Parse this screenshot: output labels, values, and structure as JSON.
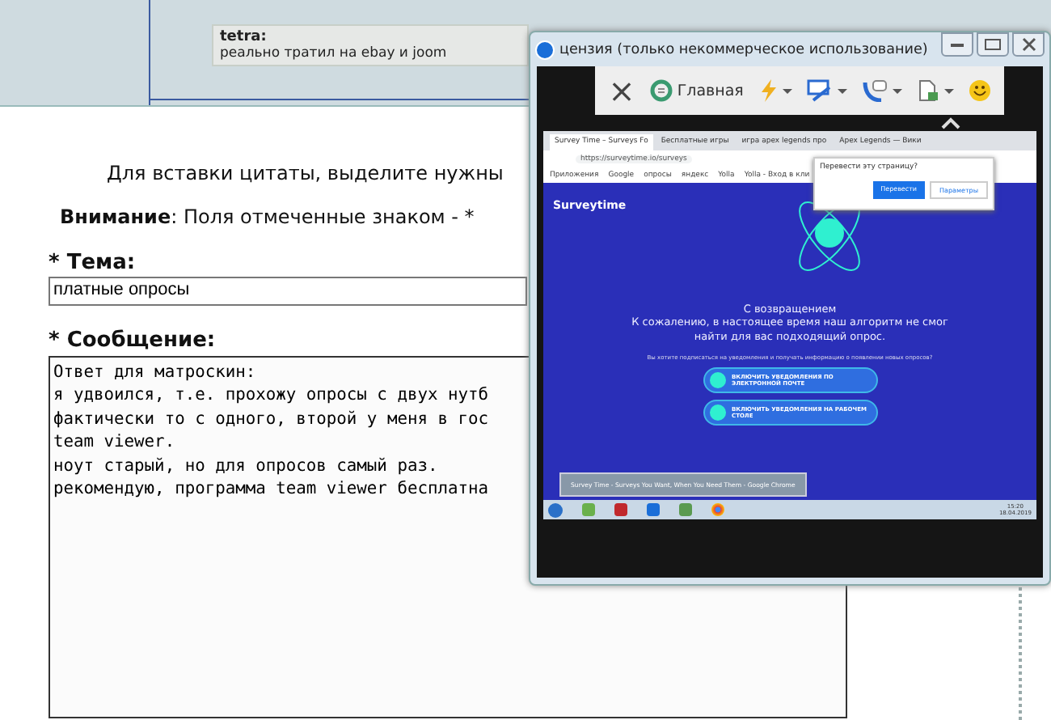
{
  "quote": {
    "author": "tetra:",
    "text": "реально тратил на ebay и joom"
  },
  "form": {
    "hint": "Для вставки цитаты, выделите нужны",
    "warning": "**Внимание**: Поля отмеченные знаком - *",
    "subject_label": "* Тема:",
    "subject_value": "платные опросы",
    "message_label": "* Сообщение:",
    "message_lines": [
      "Ответ для матроскин:",
      "я удвоился, т.е. прохожу опросы с двух нутб",
      "фактически то с одного, второй у меня в гос",
      "team viewer.",
      "ноут старый, но для опросов самый раз.",
      "рекомендую, программа team viewer бесплатна"
    ]
  },
  "remote_window": {
    "title": "цензия (только некоммерческое использование)",
    "toolbar": [
      {
        "kind": "close",
        "label": "×"
      },
      {
        "kind": "home",
        "label": "Главная"
      },
      {
        "kind": "actions"
      },
      {
        "kind": "view"
      },
      {
        "kind": "communicate"
      },
      {
        "kind": "files"
      },
      {
        "kind": "smiley"
      }
    ],
    "browser": {
      "tabs": [
        {
          "label": "Survey Time – Surveys Fo",
          "selected": true
        },
        {
          "label": "Бесплатные игры",
          "selected": false
        },
        {
          "label": "игра apex legends про",
          "selected": false
        },
        {
          "label": "Apex Legends — Вики",
          "selected": false
        }
      ],
      "url": "https://surveytime.io/surveys",
      "bookmarks": [
        "Приложения",
        "Google",
        "опросы",
        "яндекс",
        "Yolla",
        "Yolla - Вход в кли"
      ],
      "translate_popup": {
        "question": "Перевести эту страницу?",
        "primary": "Перевести",
        "secondary": "Параметры"
      },
      "site": {
        "logo": "Surveytime",
        "greeting": "С возвращением",
        "message": "К сожалению, в настоящее время наш алгоритм не смог найти для вас подходящий опрос.",
        "subscribe": "Вы хотите подписаться на уведомления и получать информацию о появлении новых опросов?",
        "buttons": [
          "ВКЛЮЧИТЬ УВЕДОМЛЕНИЯ ПО ЭЛЕКТРОННОЙ ПОЧТЕ",
          "ВКЛЮЧИТЬ УВЕДОМЛЕНИЯ НА РАБОЧЕМ СТОЛЕ"
        ]
      }
    },
    "taskbar": {
      "tooltip": "Survey Time - Surveys You Want, When You Need Them - Google Chrome",
      "clock": "15:20",
      "date": "18.04.2019"
    }
  }
}
